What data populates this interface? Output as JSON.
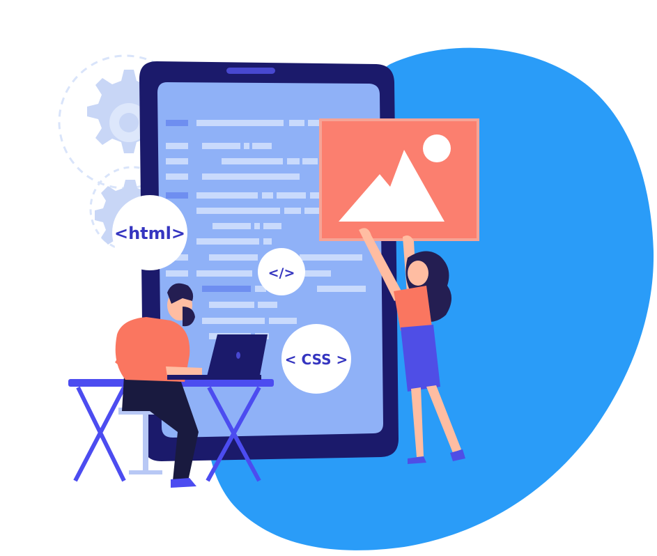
{
  "labels": {
    "html_tag": "<html>",
    "code_tag": "</>",
    "css_tag": "< CSS >"
  },
  "colors": {
    "blob": "#2a9cf8",
    "device_frame": "#1b1a6b",
    "screen": "#8fb1f7",
    "code_bar": "#c9dafc",
    "code_bar_accent": "#6e8ef0",
    "photo_card": "#fb7f6f",
    "photo_card_edge": "#f6a496",
    "gear": "#c8d6f6",
    "table": "#4c4cf0",
    "shirt": "#fa7660",
    "pants": "#191a3f",
    "skin": "#ffbda2",
    "hair": "#241e52",
    "skirt": "#4f4ee6",
    "text_accent": "#3535c0"
  },
  "icons": [
    "gear-icon",
    "mountain-image-icon",
    "laptop-icon"
  ]
}
